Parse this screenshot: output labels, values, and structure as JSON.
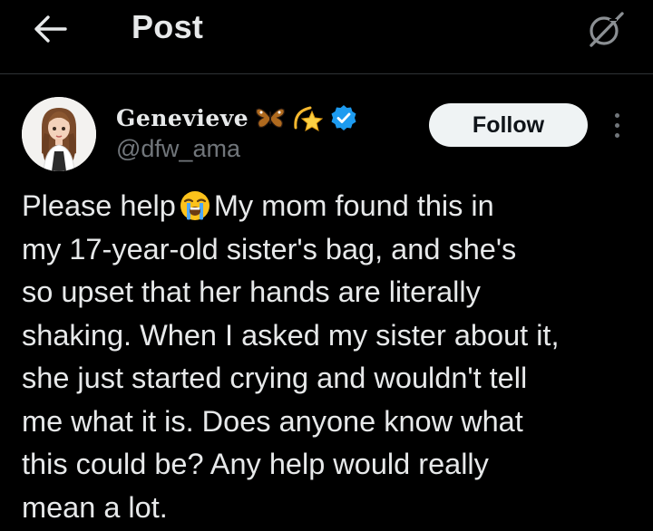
{
  "header": {
    "title": "Post",
    "back_icon": "arrow-left-icon",
    "grok_icon": "grok-icon"
  },
  "author": {
    "display_name": "Genevieve",
    "name_emojis": [
      "butterfly-icon",
      "dizzy-star-icon"
    ],
    "verified": true,
    "verified_color": "#1d9bf0",
    "handle": "@dfw_ama"
  },
  "actions": {
    "follow_label": "Follow",
    "more_icon": "more-vertical-icon"
  },
  "post": {
    "lines": [
      "Please help",
      "My mom found this in",
      "my 17-year-old sister's bag, and she's",
      "so upset that her hands are literally",
      "shaking. When I asked my sister about it,",
      "she just started crying and wouldn't tell",
      "me what it is. Does anyone know what",
      "this could be? Any help would really",
      "mean a lot."
    ],
    "inline_emoji": "loudly-crying-face-icon"
  },
  "colors": {
    "background": "#000000",
    "text_primary": "#e7e9ea",
    "text_secondary": "#71767b",
    "divider": "#2f3336",
    "follow_bg": "#eff3f4"
  }
}
